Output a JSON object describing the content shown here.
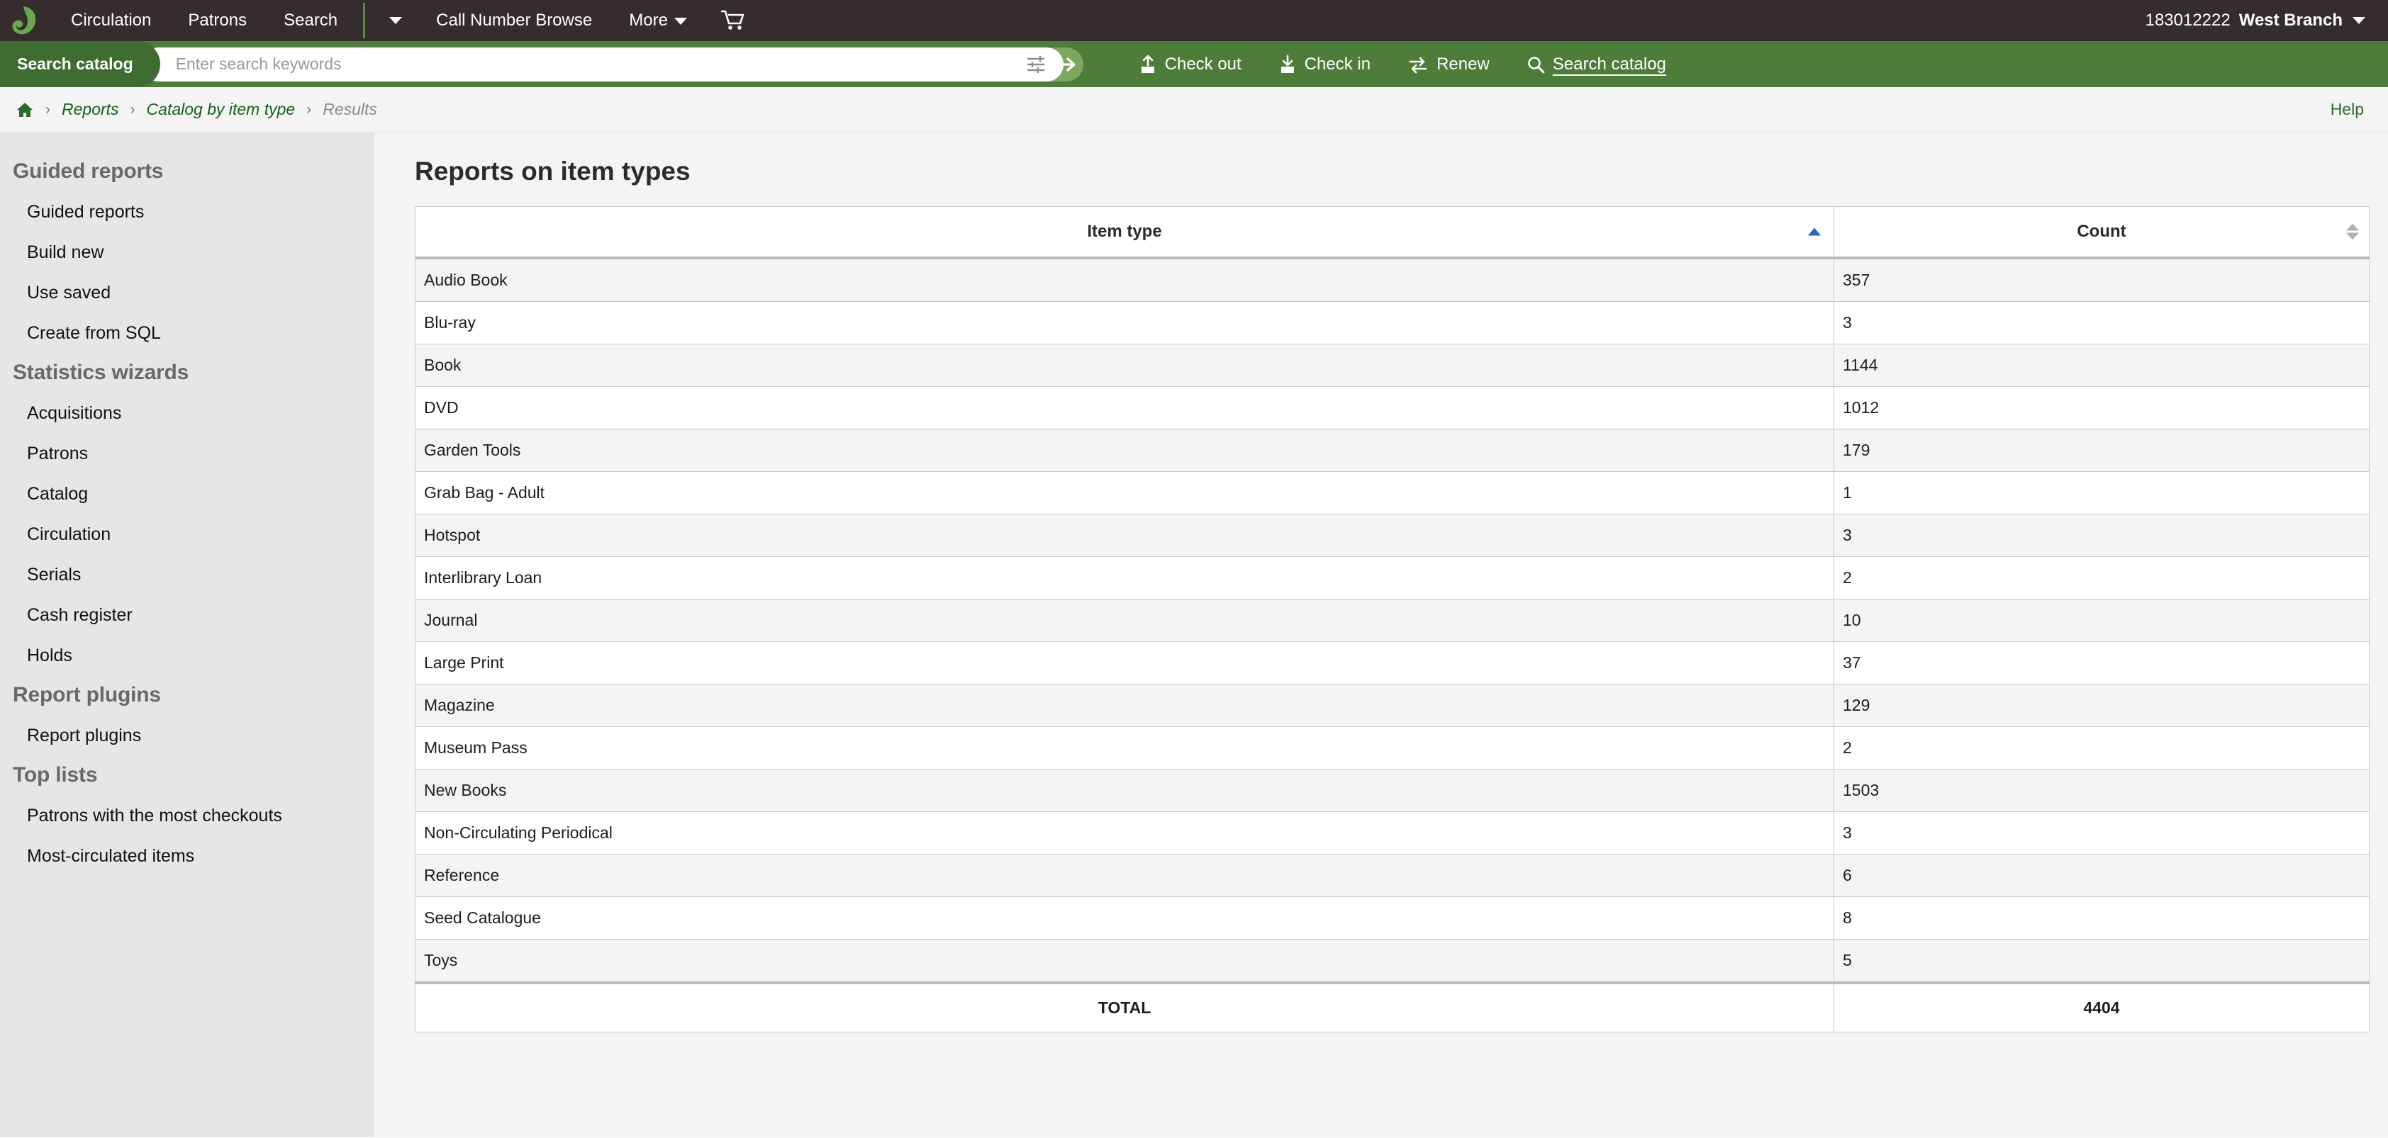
{
  "navbar": {
    "logo_icon": "koha-leaf-logo",
    "items": [
      {
        "label": "Circulation"
      },
      {
        "label": "Patrons"
      },
      {
        "label": "Search"
      }
    ],
    "more_dropdown_icon": "chevron-down-icon",
    "items_after": [
      {
        "label": "Call Number Browse"
      },
      {
        "label": "More"
      }
    ],
    "cart_icon": "shopping-cart-icon",
    "user": {
      "id": "183012222",
      "branch": "West Branch",
      "caret_icon": "chevron-down-icon"
    }
  },
  "searchbar": {
    "tab_label": "Search catalog",
    "placeholder": "Enter search keywords",
    "value": "",
    "filter_icon": "sliders-icon",
    "submit_icon": "arrow-right-icon",
    "actions": [
      {
        "label": "Check out",
        "icon": "check-out-icon",
        "active": false
      },
      {
        "label": "Check in",
        "icon": "check-in-icon",
        "active": false
      },
      {
        "label": "Renew",
        "icon": "renew-icon",
        "active": false
      },
      {
        "label": "Search catalog",
        "icon": "search-icon",
        "active": true
      }
    ]
  },
  "breadcrumb": {
    "home_icon": "home-icon",
    "separator": "›",
    "items": [
      {
        "label": "Reports",
        "current": false
      },
      {
        "label": "Catalog by item type",
        "current": false
      },
      {
        "label": "Results",
        "current": true
      }
    ],
    "help_label": "Help"
  },
  "sidebar": {
    "sections": [
      {
        "heading": "Guided reports",
        "items": [
          {
            "label": "Guided reports"
          },
          {
            "label": "Build new"
          },
          {
            "label": "Use saved"
          },
          {
            "label": "Create from SQL"
          }
        ]
      },
      {
        "heading": "Statistics wizards",
        "items": [
          {
            "label": "Acquisitions"
          },
          {
            "label": "Patrons"
          },
          {
            "label": "Catalog"
          },
          {
            "label": "Circulation"
          },
          {
            "label": "Serials"
          },
          {
            "label": "Cash register"
          },
          {
            "label": "Holds"
          }
        ]
      },
      {
        "heading": "Report plugins",
        "items": [
          {
            "label": "Report plugins"
          }
        ]
      },
      {
        "heading": "Top lists",
        "items": [
          {
            "label": "Patrons with the most checkouts"
          },
          {
            "label": "Most-circulated items"
          }
        ]
      }
    ]
  },
  "main": {
    "title": "Reports on item types",
    "table": {
      "columns": [
        {
          "label": "Item type",
          "sort": "asc"
        },
        {
          "label": "Count",
          "sort": "none"
        }
      ],
      "rows": [
        {
          "item_type": "Audio Book",
          "count": "357"
        },
        {
          "item_type": "Blu-ray",
          "count": "3"
        },
        {
          "item_type": "Book",
          "count": "1144"
        },
        {
          "item_type": "DVD",
          "count": "1012"
        },
        {
          "item_type": "Garden Tools",
          "count": "179"
        },
        {
          "item_type": "Grab Bag - Adult",
          "count": "1"
        },
        {
          "item_type": "Hotspot",
          "count": "3"
        },
        {
          "item_type": "Interlibrary Loan",
          "count": "2"
        },
        {
          "item_type": "Journal",
          "count": "10"
        },
        {
          "item_type": "Large Print",
          "count": "37"
        },
        {
          "item_type": "Magazine",
          "count": "129"
        },
        {
          "item_type": "Museum Pass",
          "count": "2"
        },
        {
          "item_type": "New Books",
          "count": "1503"
        },
        {
          "item_type": "Non-Circulating Periodical",
          "count": "3"
        },
        {
          "item_type": "Reference",
          "count": "6"
        },
        {
          "item_type": "Seed Catalogue",
          "count": "8"
        },
        {
          "item_type": "Toys",
          "count": "5"
        }
      ],
      "total_label": "TOTAL",
      "total_value": "4404"
    }
  },
  "colors": {
    "navbar_bg": "#352c2e",
    "search_bg": "#4e7d3a",
    "accent_green": "#7ba75f",
    "link_green": "#16611a",
    "sort_active_blue": "#2a62bc",
    "sidebar_bg": "#e6e6e6"
  }
}
